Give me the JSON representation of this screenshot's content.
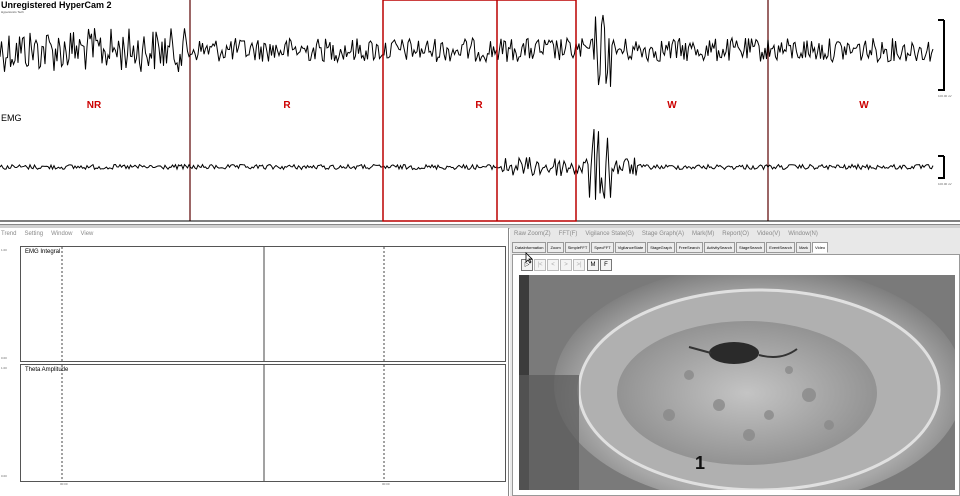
{
  "watermark": {
    "title": "Unregistered HyperCam 2",
    "subtitle": "Hyperionics Tech"
  },
  "signals": {
    "emg_label": "EMG"
  },
  "stages": [
    "NR",
    "R",
    "R",
    "W",
    "W"
  ],
  "scale_labels": [
    "100.00 uV",
    "100.00 uV"
  ],
  "left_panel": {
    "menu": [
      "Trend",
      "Setting",
      "Window",
      "View"
    ],
    "graphs": [
      {
        "title": "EMG Integral",
        "y_top": "1.00",
        "y_bottom": "0.00"
      },
      {
        "title": "Theta Amplitude",
        "y_top": "1.00",
        "y_bottom": "0.00"
      }
    ],
    "x_ticks": [
      "00:00",
      "00:00"
    ]
  },
  "right_panel": {
    "menu": [
      "Raw Zoom(Z)",
      "FFT(F)",
      "Vigilance State(G)",
      "Stage Graph(A)",
      "Mark(M)",
      "Report(O)",
      "Video(V)",
      "Window(N)"
    ],
    "tabs": [
      "DataInformation",
      "Zoom",
      "SimpleFFT",
      "SpecFFT",
      "VigilanceState",
      "StageGraph",
      "FreeSearch",
      "ActivitySearch",
      "StageSearch",
      "EventSearch",
      "Mark",
      "Video"
    ],
    "active_tab": "Video",
    "toolbar": [
      "▷",
      "|<",
      "<",
      ">",
      ">|",
      "M",
      "F"
    ],
    "video_frame_number": "1"
  },
  "colors": {
    "stage_text": "#cc0000",
    "selection_box": "#bb0000",
    "epoch_line": "#5a0000"
  }
}
